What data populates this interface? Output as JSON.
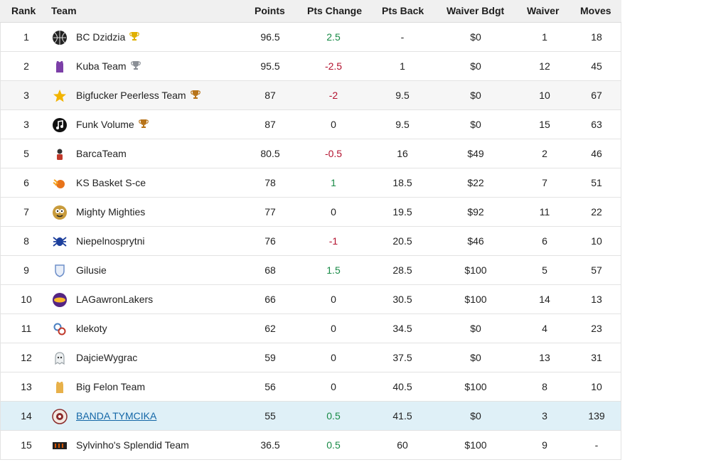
{
  "columns": {
    "rank": "Rank",
    "team": "Team",
    "points": "Points",
    "pts_change": "Pts Change",
    "pts_back": "Pts Back",
    "waiver_bdgt": "Waiver Bdgt",
    "waiver": "Waiver",
    "moves": "Moves"
  },
  "rows": [
    {
      "rank": "1",
      "team": "BC Dzidzia",
      "points": "96.5",
      "change": "2.5",
      "change_sign": "pos",
      "back": "-",
      "bdgt": "$0",
      "waiver": "1",
      "moves": "18",
      "trophy": "gold",
      "logo": "basketball-logo",
      "logo_color": "#222222"
    },
    {
      "rank": "2",
      "team": "Kuba Team",
      "points": "95.5",
      "change": "-2.5",
      "change_sign": "neg",
      "back": "1",
      "bdgt": "$0",
      "waiver": "12",
      "moves": "45",
      "trophy": "silver",
      "logo": "jersey-logo",
      "logo_color": "#7c3fa8"
    },
    {
      "rank": "3",
      "team": "Bigfucker Peerless Team",
      "points": "87",
      "change": "-2",
      "change_sign": "neg",
      "back": "9.5",
      "bdgt": "$0",
      "waiver": "10",
      "moves": "67",
      "trophy": "bronze",
      "logo": "star-logo",
      "logo_color": "#f2b400"
    },
    {
      "rank": "3",
      "team": "Funk Volume",
      "points": "87",
      "change": "0",
      "change_sign": "zero",
      "back": "9.5",
      "bdgt": "$0",
      "waiver": "15",
      "moves": "63",
      "trophy": "bronze",
      "logo": "music-logo",
      "logo_color": "#111111"
    },
    {
      "rank": "5",
      "team": "BarcaTeam",
      "points": "80.5",
      "change": "-0.5",
      "change_sign": "neg",
      "back": "16",
      "bdgt": "$49",
      "waiver": "2",
      "moves": "46",
      "trophy": "",
      "logo": "player-logo",
      "logo_color": "#c0392b"
    },
    {
      "rank": "6",
      "team": "KS Basket S-ce",
      "points": "78",
      "change": "1",
      "change_sign": "pos",
      "back": "18.5",
      "bdgt": "$22",
      "waiver": "7",
      "moves": "51",
      "trophy": "",
      "logo": "fire-ball-logo",
      "logo_color": "#e8731a"
    },
    {
      "rank": "7",
      "team": "Mighty Mighties",
      "points": "77",
      "change": "0",
      "change_sign": "zero",
      "back": "19.5",
      "bdgt": "$92",
      "waiver": "11",
      "moves": "22",
      "trophy": "",
      "logo": "monster-logo",
      "logo_color": "#c89b3c"
    },
    {
      "rank": "8",
      "team": "Niepelnosprytni",
      "points": "76",
      "change": "-1",
      "change_sign": "neg",
      "back": "20.5",
      "bdgt": "$46",
      "waiver": "6",
      "moves": "10",
      "trophy": "",
      "logo": "spider-logo",
      "logo_color": "#1c3f9c"
    },
    {
      "rank": "9",
      "team": "Gilusie",
      "points": "68",
      "change": "1.5",
      "change_sign": "pos",
      "back": "28.5",
      "bdgt": "$100",
      "waiver": "5",
      "moves": "57",
      "trophy": "",
      "logo": "shield-logo",
      "logo_color": "#6e8fc9"
    },
    {
      "rank": "10",
      "team": "LAGawronLakers",
      "points": "66",
      "change": "0",
      "change_sign": "zero",
      "back": "30.5",
      "bdgt": "$100",
      "waiver": "14",
      "moves": "13",
      "trophy": "",
      "logo": "lakers-logo",
      "logo_color": "#552583"
    },
    {
      "rank": "11",
      "team": "klekoty",
      "points": "62",
      "change": "0",
      "change_sign": "zero",
      "back": "34.5",
      "bdgt": "$0",
      "waiver": "4",
      "moves": "23",
      "trophy": "",
      "logo": "rings-logo",
      "logo_color": "#4a7fc1"
    },
    {
      "rank": "12",
      "team": "DajcieWygrac",
      "points": "59",
      "change": "0",
      "change_sign": "zero",
      "back": "37.5",
      "bdgt": "$0",
      "waiver": "13",
      "moves": "31",
      "trophy": "",
      "logo": "ghost-logo",
      "logo_color": "#9aa3a8"
    },
    {
      "rank": "13",
      "team": "Big Felon Team",
      "points": "56",
      "change": "0",
      "change_sign": "zero",
      "back": "40.5",
      "bdgt": "$100",
      "waiver": "8",
      "moves": "10",
      "trophy": "",
      "logo": "jersey-logo",
      "logo_color": "#e8b14a"
    },
    {
      "rank": "14",
      "team": "BANDA TYMCIKA",
      "points": "55",
      "change": "0.5",
      "change_sign": "pos",
      "back": "41.5",
      "bdgt": "$0",
      "waiver": "3",
      "moves": "139",
      "trophy": "",
      "logo": "emblem-logo",
      "logo_color": "#8b2b2b",
      "highlight": true
    },
    {
      "rank": "15",
      "team": "Sylvinho's Splendid Team",
      "points": "36.5",
      "change": "0.5",
      "change_sign": "pos",
      "back": "60",
      "bdgt": "$100",
      "waiver": "9",
      "moves": "-",
      "trophy": "",
      "logo": "bars-logo",
      "logo_color": "#222222"
    }
  ]
}
